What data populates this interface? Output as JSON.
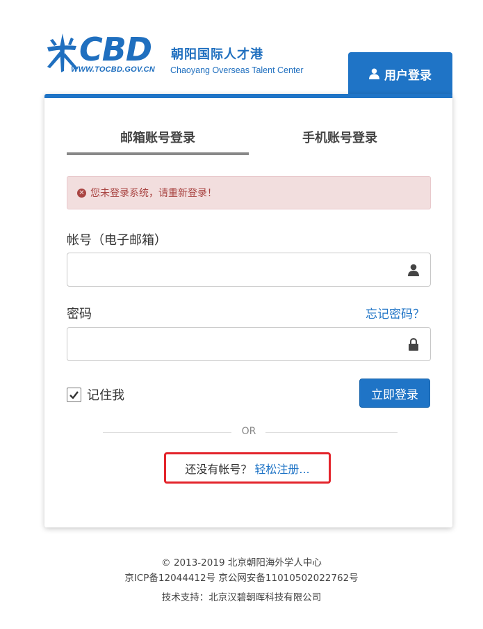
{
  "logo": {
    "brand": "CBD",
    "url": "WWW.TOCBD.GOV.CN",
    "name_cn": "朝阳国际人才港",
    "name_en": "Chaoyang Overseas Talent Center"
  },
  "user_tab": {
    "label": "用户登录",
    "icon": "user-icon"
  },
  "tabs": [
    {
      "label": "邮箱账号登录",
      "active": true
    },
    {
      "label": "手机账号登录",
      "active": false
    }
  ],
  "alert": {
    "text": "您未登录系统，请重新登录！",
    "icon": "error-circle-icon"
  },
  "account": {
    "label": "帐号（电子邮箱）",
    "value": "",
    "icon": "user-icon"
  },
  "password": {
    "label": "密码",
    "value": "",
    "icon": "lock-icon",
    "forgot": "忘记密码？"
  },
  "remember": {
    "label": "记住我",
    "checked": true
  },
  "login_button": "立即登录",
  "divider_text": "OR",
  "register": {
    "question": "还没有帐号？",
    "link": "轻松注册..."
  },
  "footer": {
    "copyright": "© 2013-2019 北京朝阳海外学人中心",
    "icp": "京ICP备12044412号",
    "police": "京公网安备11010502022762号",
    "support": "技术支持：北京汉碧朝晖科技有限公司"
  },
  "colors": {
    "accent": "#1f74c6",
    "alert_bg": "#f2dede",
    "alert_text": "#a94442",
    "highlight": "#e3242b"
  }
}
